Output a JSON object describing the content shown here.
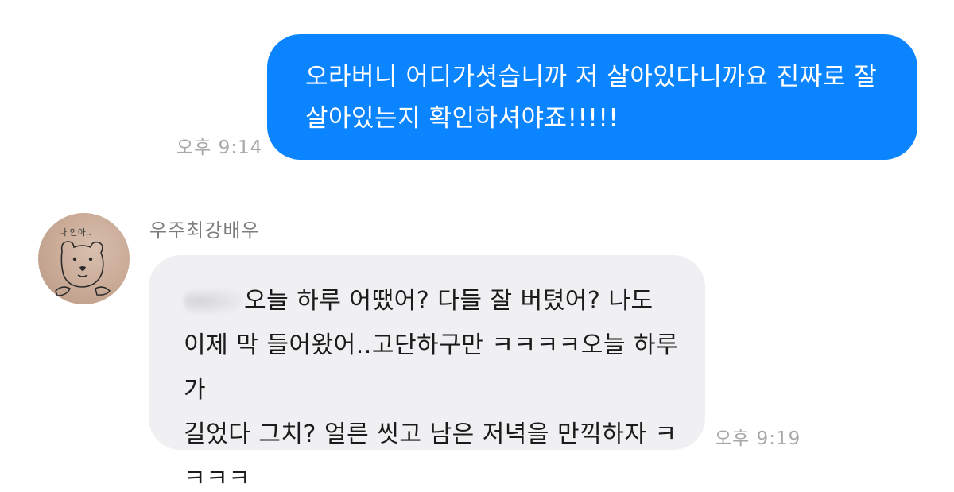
{
  "messages": {
    "outgoing": {
      "text_line1": "오라버니 어디가셧습니까 저 살아있다니까요 진짜로 잘",
      "text_line2": "살아있는지 확인하셔야죠!!!!!",
      "time": "오후 9:14"
    },
    "incoming": {
      "sender": "우주최강배우",
      "avatar_caption": "나 안아..",
      "text_line1": "오늘 하루 어땠어? 다들 잘 버텼어? 나도",
      "text_line2": "이제 막 들어왔어..고단하구만 ㅋㅋㅋㅋ오늘 하루가",
      "text_line3": "길었다 그치? 얼른 씻고 남은 저녁을 만끽하자 ㅋ",
      "text_line4": "ㅋㅋㅋ",
      "time": "오후 9:19"
    }
  },
  "colors": {
    "outgoing_bubble": "#0b84ff",
    "incoming_bubble": "#f0f0f2",
    "timestamp": "#a8a8a8"
  }
}
